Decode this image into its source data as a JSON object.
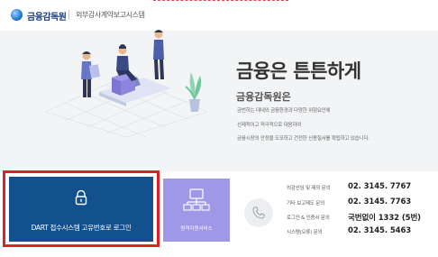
{
  "header": {
    "org_name": "금융감독원",
    "system_name": "외부감사계약보고시스템"
  },
  "hero": {
    "slogan": "금융은 튼튼하게",
    "subtitle": "금융감독원은",
    "desc_lines": [
      "금번하는 대내외 금융환경과 다양한 위험요인에",
      "선제적이고 적극적으로 대응하여",
      "금융시장의 안정을 도모하고 건전한 신용질서를 확립하고 있습니다."
    ]
  },
  "login": {
    "label": "DART 접수시스템 고유번호로 로그인",
    "icon": "lock-icon"
  },
  "remote": {
    "label": "원격지원서비스",
    "icon": "network-icon"
  },
  "contacts": [
    {
      "label": "외감선임 및 제외 문의",
      "value": "02. 3145. 7767"
    },
    {
      "label": "기타 보고제도 문의",
      "value": "02. 3145. 7763"
    },
    {
      "label": "로그인 & 인증서 문의",
      "value": "국번없이 1332 (5번)"
    },
    {
      "label": "시스템(오류) 문의",
      "value": "02. 3145. 5463"
    }
  ],
  "colors": {
    "login_bg": "#12508e",
    "remote_bg": "#9f98e6",
    "highlight_border": "#e01f27",
    "hero_bg": "#f3f4f6"
  }
}
